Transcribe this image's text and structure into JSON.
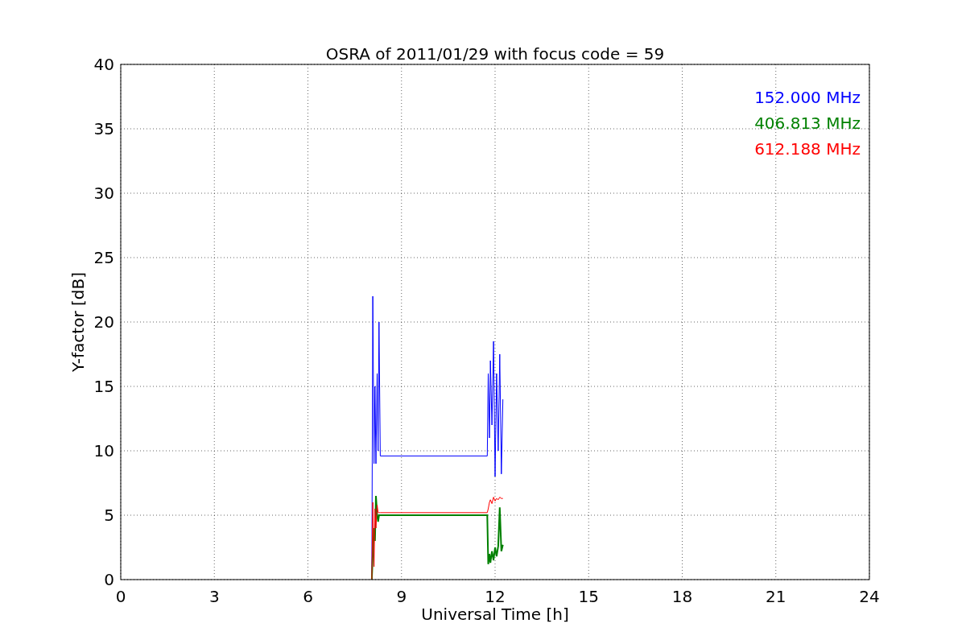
{
  "figure": {
    "chart_data": {
      "type": "line",
      "title": "OSRA of 2011/01/29 with focus code = 59",
      "xlabel": "Universal Time [h]",
      "ylabel": "Y-factor [dB]",
      "x": [
        8.05,
        8.08,
        8.12,
        8.15,
        8.18,
        8.22,
        8.25,
        8.28,
        8.32,
        11.75,
        11.78,
        11.82,
        11.85,
        11.9,
        11.95,
        12.0,
        12.05,
        12.1,
        12.15,
        12.2,
        12.25
      ],
      "series": [
        {
          "name": "152.000 MHz",
          "color": "#0000ff",
          "values": [
            0,
            22,
            9,
            15,
            9,
            16,
            10,
            20,
            9.6,
            9.6,
            16,
            11,
            17,
            12,
            18.5,
            8,
            16,
            10,
            17.5,
            8.2,
            14
          ]
        },
        {
          "name": "406.813 MHz",
          "color": "#008000",
          "values": [
            0,
            2,
            4,
            3,
            6.5,
            5,
            4.5,
            5,
            5,
            5,
            1.2,
            2,
            1.3,
            2.2,
            1.5,
            2.5,
            1.8,
            2.6,
            5.6,
            2.2,
            2.7
          ]
        },
        {
          "name": "612.188 MHz",
          "color": "#ff0000",
          "values": [
            0,
            6,
            1,
            5.5,
            4,
            5.8,
            5.2,
            5.2,
            5.2,
            5.2,
            5.5,
            6,
            6.2,
            5.9,
            6.4,
            6.1,
            6.3,
            6.2,
            6.4,
            6.3,
            6.3
          ]
        }
      ],
      "grid": true,
      "xlim": [
        0,
        24
      ],
      "ylim": [
        0,
        40
      ],
      "xticks": [
        0,
        3,
        6,
        9,
        12,
        15,
        18,
        21,
        24
      ],
      "yticks": [
        0,
        5,
        10,
        15,
        20,
        25,
        30,
        35,
        40
      ]
    }
  }
}
